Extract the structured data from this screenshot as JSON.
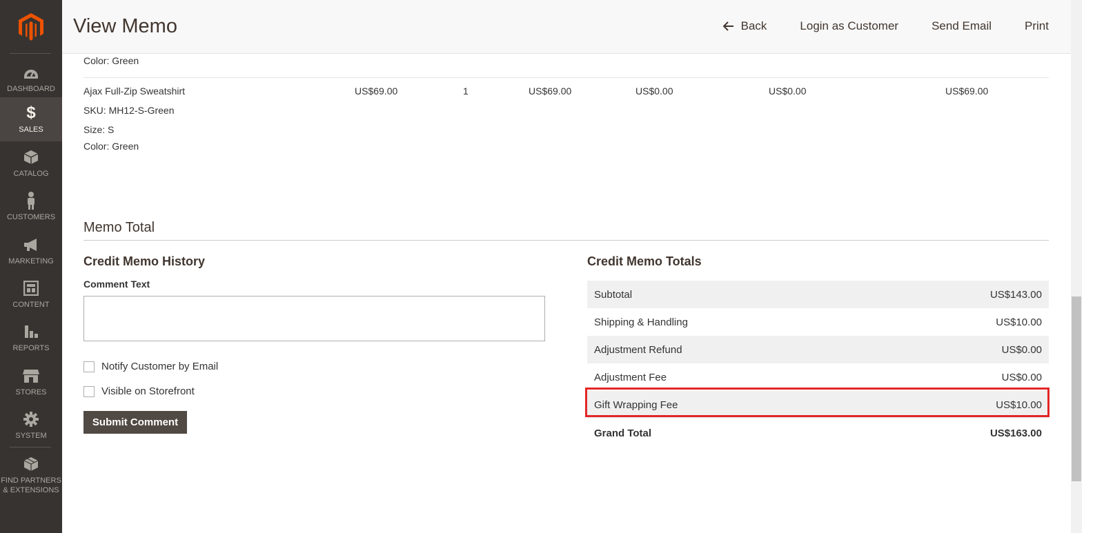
{
  "sidebar": {
    "items": [
      {
        "label": "DASHBOARD",
        "icon": "dashboard-icon"
      },
      {
        "label": "SALES",
        "icon": "dollar-icon",
        "active": true
      },
      {
        "label": "CATALOG",
        "icon": "box-icon"
      },
      {
        "label": "CUSTOMERS",
        "icon": "person-icon"
      },
      {
        "label": "MARKETING",
        "icon": "megaphone-icon"
      },
      {
        "label": "CONTENT",
        "icon": "layout-icon"
      },
      {
        "label": "REPORTS",
        "icon": "bar-chart-icon"
      },
      {
        "label": "STORES",
        "icon": "store-icon"
      },
      {
        "label": "SYSTEM",
        "icon": "gear-icon"
      }
    ],
    "partners_line1": "FIND PARTNERS",
    "partners_line2": "& EXTENSIONS",
    "accent_color": "#eb5202"
  },
  "header": {
    "title": "View Memo",
    "actions": {
      "back": "Back",
      "login_as_customer": "Login as Customer",
      "send_email": "Send Email",
      "print": "Print"
    }
  },
  "items": {
    "previous_color": "Color: Green",
    "row": {
      "name": "Ajax Full-Zip Sweatshirt",
      "sku": "SKU: MH12-S-Green",
      "size": "Size: S",
      "color": "Color: Green",
      "price": "US$69.00",
      "qty": "1",
      "subtotal": "US$69.00",
      "tax": "US$0.00",
      "discount": "US$0.00",
      "row_total": "US$69.00"
    }
  },
  "memo_total": {
    "title": "Memo Total",
    "history": {
      "title": "Credit Memo History",
      "comment_label": "Comment Text",
      "comment_value": "",
      "notify_label": "Notify Customer by Email",
      "visible_label": "Visible on Storefront",
      "submit_label": "Submit Comment"
    },
    "totals": {
      "title": "Credit Memo Totals",
      "rows": [
        {
          "label": "Subtotal",
          "value": "US$143.00"
        },
        {
          "label": "Shipping & Handling",
          "value": "US$10.00"
        },
        {
          "label": "Adjustment Refund",
          "value": "US$0.00"
        },
        {
          "label": "Adjustment Fee",
          "value": "US$0.00"
        },
        {
          "label": "Gift Wrapping Fee",
          "value": "US$10.00"
        }
      ],
      "grand_label": "Grand Total",
      "grand_value": "US$163.00"
    },
    "highlight_color": "#e22626"
  }
}
